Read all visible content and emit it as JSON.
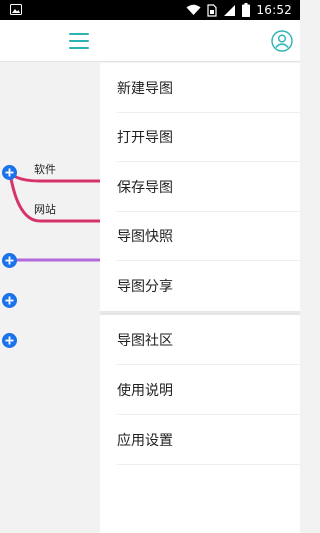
{
  "status_bar": {
    "time": "16:52",
    "icons": [
      "image-icon",
      "wifi-icon",
      "sim-icon",
      "signal-icon",
      "battery-icon"
    ]
  },
  "header": {
    "icons": [
      "menu-icon",
      "user-icon"
    ],
    "accent_color": "#2bb3b3"
  },
  "canvas": {
    "branches": [
      {
        "label": "软件",
        "color": "#d6336c"
      },
      {
        "label": "网站",
        "color": "#d6336c"
      }
    ],
    "purple_branch_color": "#b36ad9",
    "node_color": "#1a73e8"
  },
  "drawer": {
    "menu": [
      {
        "label": "新建导图"
      },
      {
        "label": "打开导图"
      },
      {
        "label": "保存导图"
      },
      {
        "label": "导图快照"
      },
      {
        "label": "导图分享"
      },
      {
        "label": "导图社区"
      },
      {
        "label": "使用说明"
      },
      {
        "label": "应用设置"
      }
    ]
  }
}
